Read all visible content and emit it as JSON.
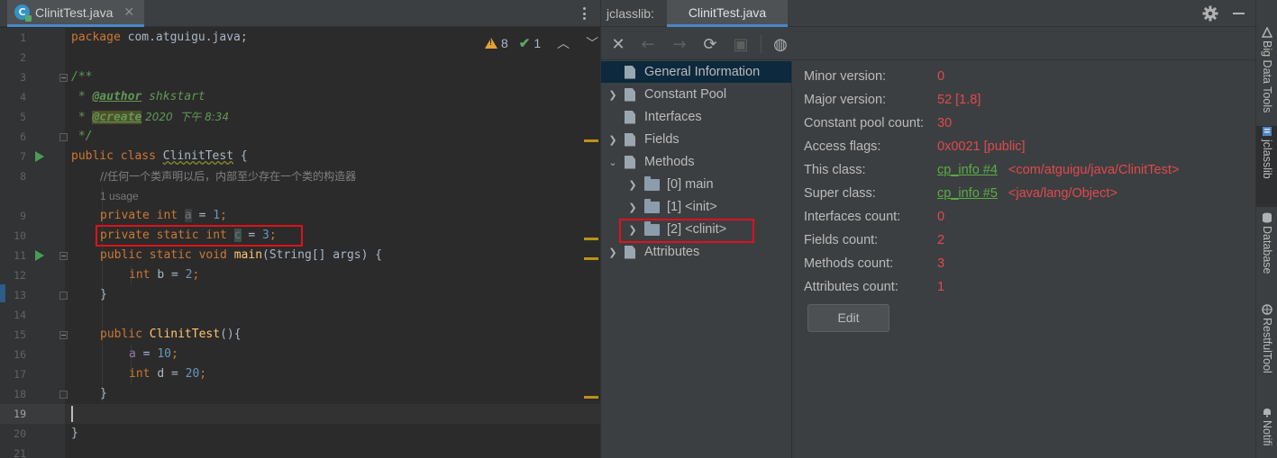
{
  "editor": {
    "tab": {
      "label": "ClinitTest.java",
      "close": "✕"
    },
    "inspection": {
      "warnings": "8",
      "weak_warnings": "1"
    },
    "line_numbers": [
      "1",
      "2",
      "3",
      "4",
      "5",
      "6",
      "7",
      "8",
      "9",
      "10",
      "11",
      "12",
      "13",
      "14",
      "15",
      "16",
      "17",
      "18",
      "19",
      "20",
      "21"
    ],
    "code": {
      "l1_keyword": "package",
      "l1_rest": " com.atguigu.java;",
      "l3": "/**",
      "l4_star": " * ",
      "l4_tag": "@author",
      "l4_rest": " shkstart",
      "l5_star": " * ",
      "l5_tag": "@create",
      "l5_rest": " 2020  下午 8:34",
      "l6": " */",
      "l7_kw": "public class ",
      "l7_name": "ClinitTest",
      "l7_rest": " {",
      "l8_comment": "//任何一个类声明以后，内部至少存在一个类的构造器",
      "inlay_usage": "1 usage",
      "l9_kw": "private int ",
      "l9_var": "a",
      "l9_eq": " = ",
      "l9_num": "1",
      "l9_end": ";",
      "l10_kw": "private static int ",
      "l10_var": "c",
      "l10_eq": " = ",
      "l10_num": "3",
      "l10_end": ";",
      "l11_kw": "public static void ",
      "l11_name": "main",
      "l11_rest": "(String[] args) {",
      "l12_kw": "int ",
      "l12_rest": "b = ",
      "l12_num": "2",
      "l12_end": ";",
      "l13": "}",
      "l15_kw": "public ",
      "l15_name": "ClinitTest",
      "l15_rest": "(){",
      "l16_var": "a",
      "l16_eq": " = ",
      "l16_num": "10",
      "l16_end": ";",
      "l17_kw": "int ",
      "l17_rest": "d = ",
      "l17_num": "20",
      "l17_end": ";",
      "l18": "}",
      "l20": "}"
    }
  },
  "jclasslib": {
    "title": "jclasslib:",
    "tab": "ClinitTest.java",
    "tree": {
      "general_information": "General Information",
      "constant_pool": "Constant Pool",
      "interfaces": "Interfaces",
      "fields": "Fields",
      "methods": "Methods",
      "method_0": "[0] main",
      "method_1": "[1] <init>",
      "method_2": "[2] <clinit>",
      "attributes": "Attributes"
    },
    "details": {
      "minor_version_label": "Minor version:",
      "minor_version_value": "0",
      "major_version_label": "Major version:",
      "major_version_value": "52 [1.8]",
      "constant_pool_count_label": "Constant pool count:",
      "constant_pool_count_value": "30",
      "access_flags_label": "Access flags:",
      "access_flags_value": "0x0021 [public]",
      "this_class_label": "This class:",
      "this_class_link": "cp_info #4",
      "this_class_value": "<com/atguigu/java/ClinitTest>",
      "super_class_label": "Super class:",
      "super_class_link": "cp_info #5",
      "super_class_value": "<java/lang/Object>",
      "interfaces_count_label": "Interfaces count:",
      "interfaces_count_value": "0",
      "fields_count_label": "Fields count:",
      "fields_count_value": "2",
      "methods_count_label": "Methods count:",
      "methods_count_value": "3",
      "attributes_count_label": "Attributes count:",
      "attributes_count_value": "1",
      "edit_button": "Edit"
    }
  },
  "toolstrip": {
    "big_data_tools": "Big Data Tools",
    "jclasslib": "jclasslib",
    "database": "Database",
    "restful_tool": "RestfulTool",
    "notifications": "Notifi"
  },
  "colors": {
    "highlight_box": "#e0111b",
    "tab_underline": "#4a88c7",
    "value_red": "#e0494d",
    "link_green": "#5bad44"
  }
}
